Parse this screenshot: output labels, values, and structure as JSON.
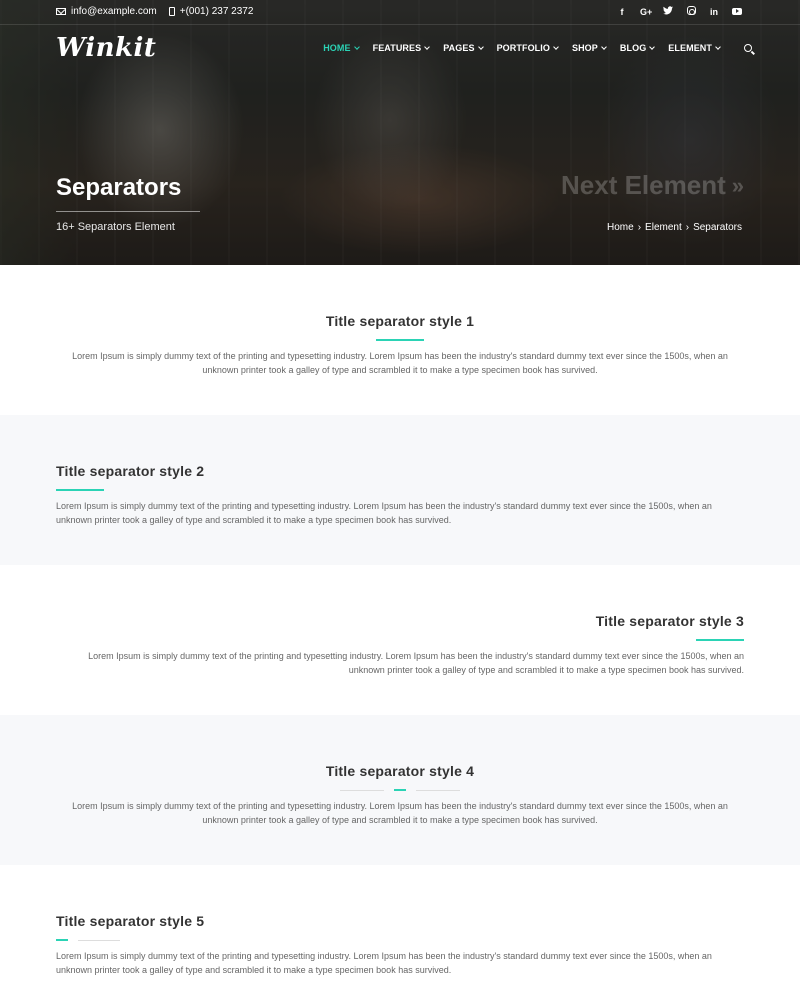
{
  "topbar": {
    "email": "info@example.com",
    "phone": "+(001) 237 2372",
    "social": [
      "f",
      "G+",
      "twitter-icon",
      "instagram-icon",
      "in",
      "youtube-icon"
    ]
  },
  "brand": {
    "logo": "Winkit"
  },
  "nav": {
    "items": [
      "HOME",
      "FEATURES",
      "PAGES",
      "PORTFOLIO",
      "SHOP",
      "BLOG",
      "ELEMENT"
    ],
    "active": "HOME"
  },
  "hero": {
    "title": "Separators",
    "subtitle": "16+ Separators Element",
    "next_label": "Next Element",
    "next_arrows": "»",
    "breadcrumb": [
      "Home",
      "Element",
      "Separators"
    ],
    "breadcrumb_sep": "›"
  },
  "colors": {
    "accent": "#2bd3b5",
    "alt_bg": "#f7f8fa",
    "text": "#666666",
    "title": "#333333"
  },
  "sections": [
    {
      "title": "Title separator style 1",
      "text": "Lorem Ipsum is simply dummy text of the printing and typesetting industry. Lorem Ipsum has been the industry's standard dummy text ever since the 1500s, when an unknown printer took a galley of type and scrambled it to make a type specimen book has survived."
    },
    {
      "title": "Title separator style 2",
      "text": "Lorem Ipsum is simply dummy text of the printing and typesetting industry. Lorem Ipsum has been the industry's standard dummy text ever since the 1500s, when an unknown printer took a galley of type and scrambled it to make a type specimen book has survived."
    },
    {
      "title": "Title separator style 3",
      "text": "Lorem Ipsum is simply dummy text of the printing and typesetting industry. Lorem Ipsum has been the industry's standard dummy text ever since the 1500s, when an unknown printer took a galley of type and scrambled it to make a type specimen book has survived."
    },
    {
      "title": "Title separator style 4",
      "text": "Lorem Ipsum is simply dummy text of the printing and typesetting industry. Lorem Ipsum has been the industry's standard dummy text ever since the 1500s, when an unknown printer took a galley of type and scrambled it to make a type specimen book has survived."
    },
    {
      "title": "Title separator style 5",
      "text": "Lorem Ipsum is simply dummy text of the printing and typesetting industry. Lorem Ipsum has been the industry's standard dummy text ever since the 1500s, when an unknown printer took a galley of type and scrambled it to make a type specimen book has survived."
    }
  ]
}
